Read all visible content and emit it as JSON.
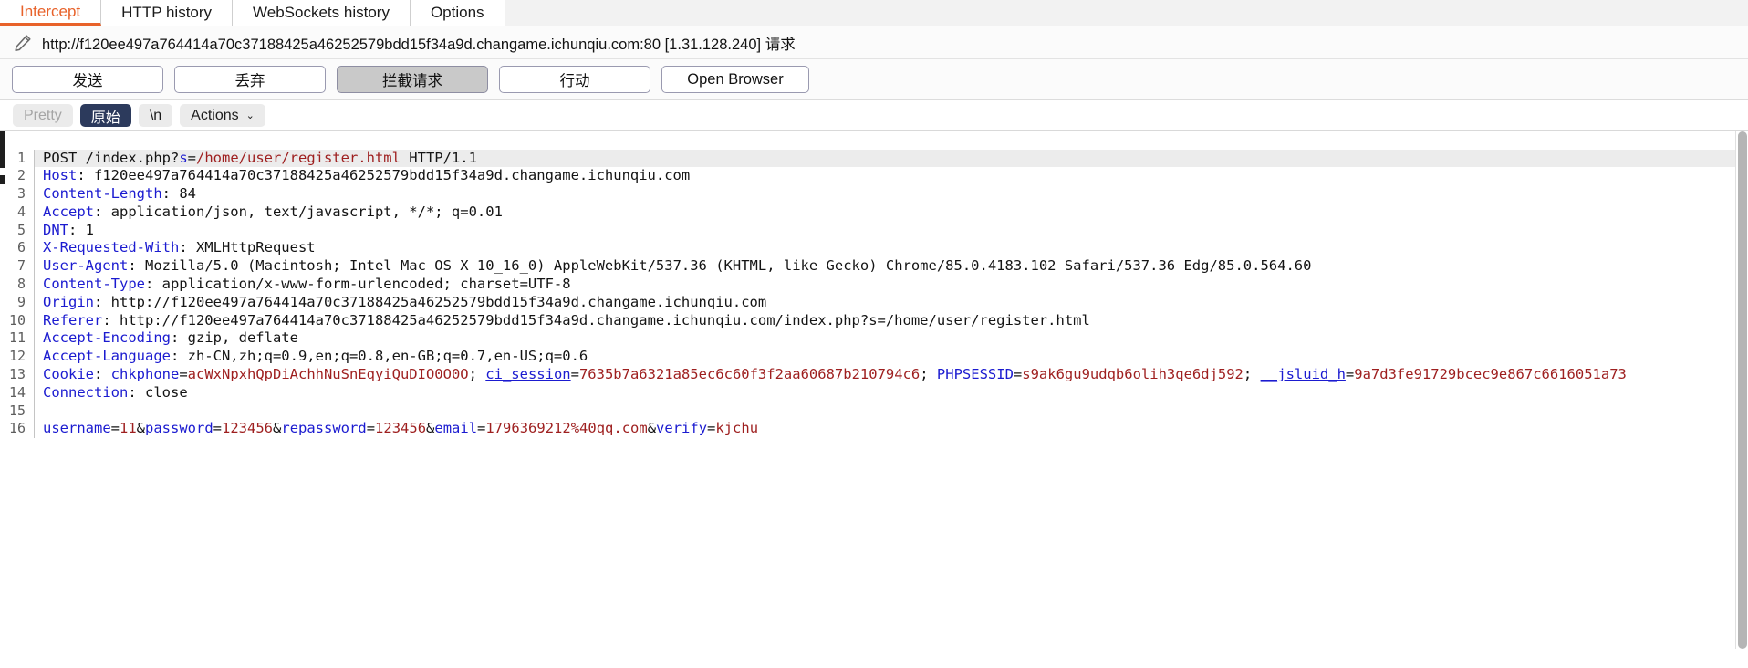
{
  "tabs": [
    {
      "label": "Intercept",
      "active": true
    },
    {
      "label": "HTTP history",
      "active": false
    },
    {
      "label": "WebSockets history",
      "active": false
    },
    {
      "label": "Options",
      "active": false
    }
  ],
  "target": {
    "icon": "pencil-icon",
    "url": "http://f120ee497a764414a70c37188425a46252579bdd15f34a9d.changame.ichunqiu.com:80  [1.31.128.240] 请求"
  },
  "actions": [
    {
      "label": "发送",
      "pressed": false
    },
    {
      "label": "丢弃",
      "pressed": false
    },
    {
      "label": "拦截请求",
      "pressed": true
    },
    {
      "label": "行动",
      "pressed": false
    },
    {
      "label": "Open Browser",
      "pressed": false
    }
  ],
  "editor_toolbar": {
    "pretty": "Pretty",
    "raw": "原始",
    "newline": "\\n",
    "actions": "Actions",
    "caret": "⌄"
  },
  "colors": {
    "accent": "#e8622a",
    "selected_tab_bg": "#2c3a5c",
    "header_name": "#1b1bd0",
    "header_value": "#9e1f1f",
    "current_line_bg": "#ececec"
  },
  "request": {
    "highlight_line": 1,
    "lines": [
      {
        "n": 1,
        "tokens": [
          {
            "t": "POST /index.php?",
            "c": "p"
          },
          {
            "t": "s",
            "c": "k"
          },
          {
            "t": "=",
            "c": "p"
          },
          {
            "t": "/home/user/register.html",
            "c": "v"
          },
          {
            "t": " HTTP/1.1",
            "c": "p"
          }
        ]
      },
      {
        "n": 2,
        "tokens": [
          {
            "t": "Host",
            "c": "k"
          },
          {
            "t": ": f120ee497a764414a70c37188425a46252579bdd15f34a9d.changame.ichunqiu.com",
            "c": "p"
          }
        ]
      },
      {
        "n": 3,
        "tokens": [
          {
            "t": "Content-Length",
            "c": "k"
          },
          {
            "t": ": 84",
            "c": "p"
          }
        ]
      },
      {
        "n": 4,
        "tokens": [
          {
            "t": "Accept",
            "c": "k"
          },
          {
            "t": ": application/json, text/javascript, */*; q=0.01",
            "c": "p"
          }
        ]
      },
      {
        "n": 5,
        "tokens": [
          {
            "t": "DNT",
            "c": "k"
          },
          {
            "t": ": 1",
            "c": "p"
          }
        ]
      },
      {
        "n": 6,
        "tokens": [
          {
            "t": "X-Requested-With",
            "c": "k"
          },
          {
            "t": ": XMLHttpRequest",
            "c": "p"
          }
        ]
      },
      {
        "n": 7,
        "tokens": [
          {
            "t": "User-Agent",
            "c": "k"
          },
          {
            "t": ": Mozilla/5.0 (Macintosh; Intel Mac OS X 10_16_0) AppleWebKit/537.36 (KHTML, like Gecko) Chrome/85.0.4183.102 Safari/537.36 Edg/85.0.564.60",
            "c": "p"
          }
        ]
      },
      {
        "n": 8,
        "tokens": [
          {
            "t": "Content-Type",
            "c": "k"
          },
          {
            "t": ": application/x-www-form-urlencoded; charset=UTF-8",
            "c": "p"
          }
        ]
      },
      {
        "n": 9,
        "tokens": [
          {
            "t": "Origin",
            "c": "k"
          },
          {
            "t": ": http://f120ee497a764414a70c37188425a46252579bdd15f34a9d.changame.ichunqiu.com",
            "c": "p"
          }
        ]
      },
      {
        "n": 10,
        "tokens": [
          {
            "t": "Referer",
            "c": "k"
          },
          {
            "t": ": http://f120ee497a764414a70c37188425a46252579bdd15f34a9d.changame.ichunqiu.com/index.php?s=/home/user/register.html",
            "c": "p"
          }
        ]
      },
      {
        "n": 11,
        "tokens": [
          {
            "t": "Accept-Encoding",
            "c": "k"
          },
          {
            "t": ": gzip, deflate",
            "c": "p"
          }
        ]
      },
      {
        "n": 12,
        "tokens": [
          {
            "t": "Accept-Language",
            "c": "k"
          },
          {
            "t": ": zh-CN,zh;q=0.9,en;q=0.8,en-GB;q=0.7,en-US;q=0.6",
            "c": "p"
          }
        ]
      },
      {
        "n": 13,
        "tokens": [
          {
            "t": "Cookie",
            "c": "k"
          },
          {
            "t": ": ",
            "c": "p"
          },
          {
            "t": "chkphone",
            "c": "k"
          },
          {
            "t": "=",
            "c": "p"
          },
          {
            "t": "acWxNpxhQpDiAchhNuSnEqyiQuDIO0O0O",
            "c": "v"
          },
          {
            "t": "; ",
            "c": "p"
          },
          {
            "t": "ci_session",
            "c": "u"
          },
          {
            "t": "=",
            "c": "p"
          },
          {
            "t": "7635b7a6321a85ec6c60f3f2aa60687b210794c6",
            "c": "v"
          },
          {
            "t": "; ",
            "c": "p"
          },
          {
            "t": "PHPSESSID",
            "c": "k"
          },
          {
            "t": "=",
            "c": "p"
          },
          {
            "t": "s9ak6gu9udqb6olih3qe6dj592",
            "c": "v"
          },
          {
            "t": "; ",
            "c": "p"
          },
          {
            "t": "__jsluid_h",
            "c": "u"
          },
          {
            "t": "=",
            "c": "p"
          },
          {
            "t": "9a7d3fe91729bcec9e867c6616051a73",
            "c": "v"
          }
        ]
      },
      {
        "n": 14,
        "tokens": [
          {
            "t": "Connection",
            "c": "k"
          },
          {
            "t": ": close",
            "c": "p"
          }
        ]
      },
      {
        "n": 15,
        "tokens": []
      },
      {
        "n": 16,
        "tokens": [
          {
            "t": "username",
            "c": "k"
          },
          {
            "t": "=",
            "c": "p"
          },
          {
            "t": "11",
            "c": "v"
          },
          {
            "t": "&",
            "c": "p"
          },
          {
            "t": "password",
            "c": "k"
          },
          {
            "t": "=",
            "c": "p"
          },
          {
            "t": "123456",
            "c": "v"
          },
          {
            "t": "&",
            "c": "p"
          },
          {
            "t": "repassword",
            "c": "k"
          },
          {
            "t": "=",
            "c": "p"
          },
          {
            "t": "123456",
            "c": "v"
          },
          {
            "t": "&",
            "c": "p"
          },
          {
            "t": "email",
            "c": "k"
          },
          {
            "t": "=",
            "c": "p"
          },
          {
            "t": "1796369212%40qq.com",
            "c": "v"
          },
          {
            "t": "&",
            "c": "p"
          },
          {
            "t": "verify",
            "c": "k"
          },
          {
            "t": "=",
            "c": "p"
          },
          {
            "t": "kjchu",
            "c": "v"
          }
        ]
      }
    ]
  }
}
